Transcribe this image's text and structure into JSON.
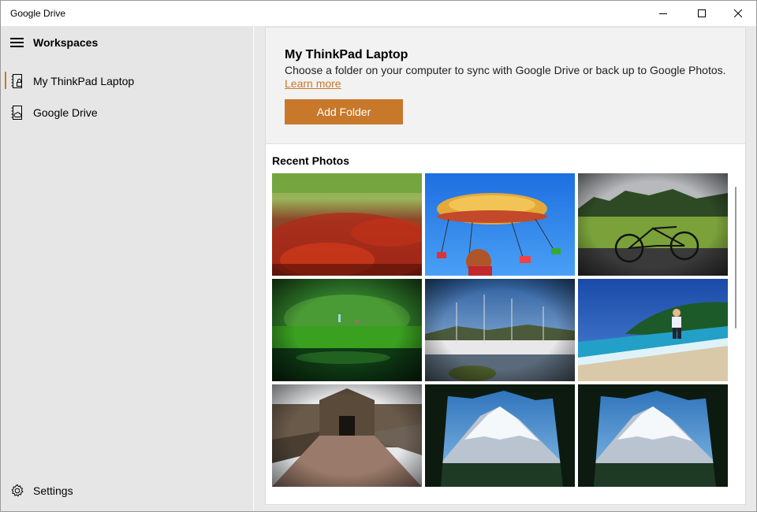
{
  "window": {
    "title": "Google Drive"
  },
  "sidebar": {
    "title": "Workspaces",
    "items": [
      {
        "label": "My ThinkPad Laptop",
        "icon": "laptop-folder-icon",
        "selected": true
      },
      {
        "label": "Google Drive",
        "icon": "drive-folder-icon",
        "selected": false
      }
    ],
    "settings_label": "Settings",
    "accent_color": "#c8782a"
  },
  "main": {
    "title": "My ThinkPad Laptop",
    "description": "Choose a folder on your computer to sync with Google Drive or back up to Google Photos.",
    "learn_more": "Learn more",
    "add_folder_label": "Add Folder",
    "recent_photos_title": "Recent Photos",
    "photos": [
      {
        "name": "photo-red-flowers-path"
      },
      {
        "name": "photo-carnival-swing-ride"
      },
      {
        "name": "photo-bicycle-field"
      },
      {
        "name": "photo-green-pond"
      },
      {
        "name": "photo-marina-boats"
      },
      {
        "name": "photo-boy-beach"
      },
      {
        "name": "photo-fort-gate"
      },
      {
        "name": "photo-snowy-mountain"
      },
      {
        "name": "photo-snowy-mountain-2"
      }
    ]
  }
}
